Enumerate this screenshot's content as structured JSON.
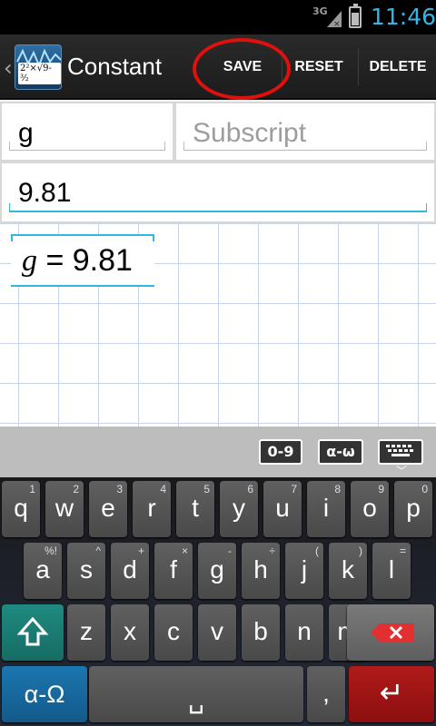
{
  "status_bar": {
    "network": "3G",
    "time": "11:46",
    "accent_color": "#33b5e5"
  },
  "action_bar": {
    "title": "Constant",
    "icon_formula": "2²×√9-³⁄₂",
    "save_label": "SAVE",
    "reset_label": "RESET",
    "delete_label": "DELETE"
  },
  "form": {
    "name_value": "g",
    "subscript_placeholder": "Subscript",
    "value_value": "9.81"
  },
  "preview": {
    "symbol": "g",
    "equals": " = 9.81"
  },
  "keyboard_toolbar": {
    "digits_label": "0-9",
    "greek_label": "α-ω"
  },
  "keyboard": {
    "row1": [
      {
        "label": "q",
        "hint": "1"
      },
      {
        "label": "w",
        "hint": "2"
      },
      {
        "label": "e",
        "hint": "3"
      },
      {
        "label": "r",
        "hint": "4"
      },
      {
        "label": "t",
        "hint": "5"
      },
      {
        "label": "y",
        "hint": "6"
      },
      {
        "label": "u",
        "hint": "7"
      },
      {
        "label": "i",
        "hint": "8"
      },
      {
        "label": "o",
        "hint": "9"
      },
      {
        "label": "p",
        "hint": "0"
      }
    ],
    "row2": [
      {
        "label": "a",
        "hint": "%!"
      },
      {
        "label": "s",
        "hint": "^"
      },
      {
        "label": "d",
        "hint": "+"
      },
      {
        "label": "f",
        "hint": "×"
      },
      {
        "label": "g",
        "hint": "-"
      },
      {
        "label": "h",
        "hint": "÷"
      },
      {
        "label": "j",
        "hint": "("
      },
      {
        "label": "k",
        "hint": ")"
      },
      {
        "label": "l",
        "hint": "="
      }
    ],
    "row3": [
      {
        "label": "z"
      },
      {
        "label": "x"
      },
      {
        "label": "c"
      },
      {
        "label": "v"
      },
      {
        "label": "b"
      },
      {
        "label": "n"
      },
      {
        "label": "m"
      }
    ],
    "alpha_label": "α-Ω",
    "comma_label": ",",
    "space_glyph": "␣",
    "enter_glyph": "↵"
  }
}
